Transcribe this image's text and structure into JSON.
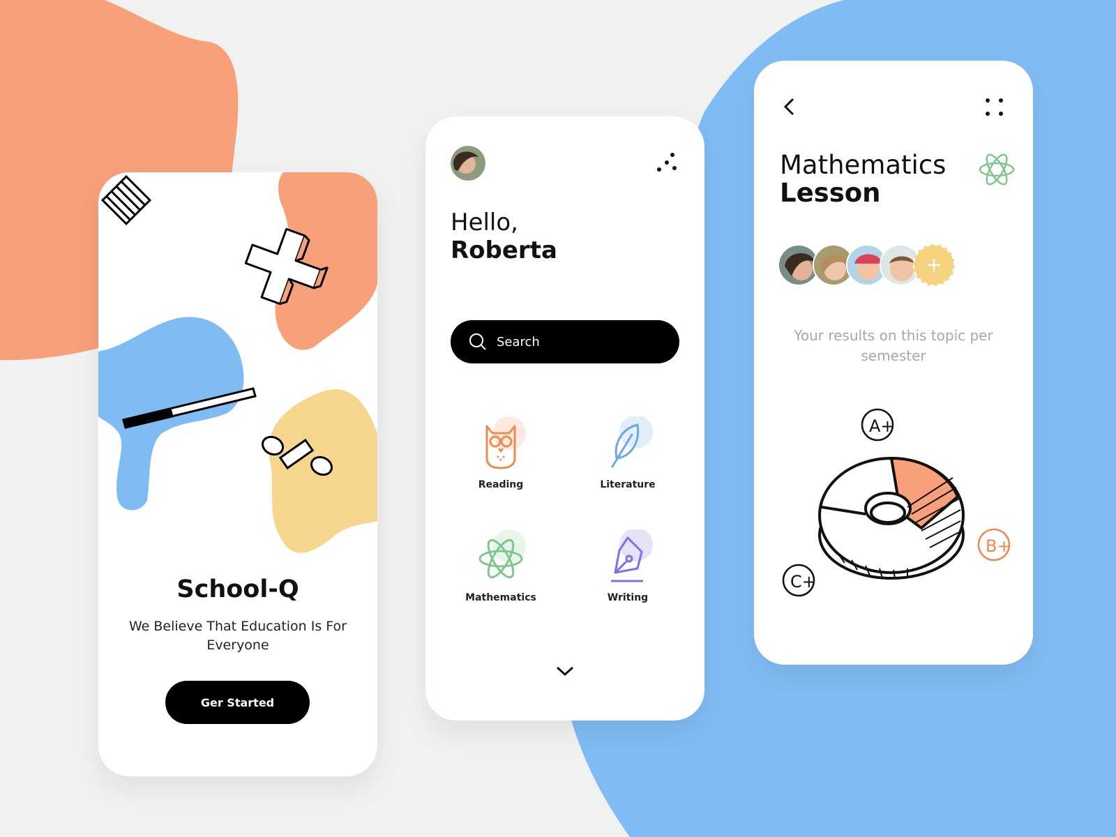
{
  "colors": {
    "background": "#f0f1f1",
    "orange": "#f7a07a",
    "blue": "#80bcf4",
    "yellow": "#f5d68c",
    "black": "#000000",
    "owl_orange": "#ee8a4e",
    "feather_blue": "#6ba7ea",
    "atom_green": "#7ec68d",
    "pen_purple": "#7d6ef0"
  },
  "welcome": {
    "app_name": "School-Q",
    "tagline": "We Believe That Education Is For Everyone",
    "button_label": "Ger Started"
  },
  "home": {
    "greeting": "Hello,",
    "user_name": "Roberta",
    "search_label": "Search",
    "categories": [
      {
        "label": "Reading",
        "icon": "owl-icon"
      },
      {
        "label": "Literature",
        "icon": "feather-icon"
      },
      {
        "label": "Mathematics",
        "icon": "atom-icon"
      },
      {
        "label": "Writing",
        "icon": "pen-nib-icon"
      }
    ]
  },
  "lesson": {
    "title_line1": "Mathematics",
    "title_line2": "Lesson",
    "results_text": "Your results on this topic per semester",
    "grades": [
      "A+",
      "B+",
      "C+"
    ]
  }
}
